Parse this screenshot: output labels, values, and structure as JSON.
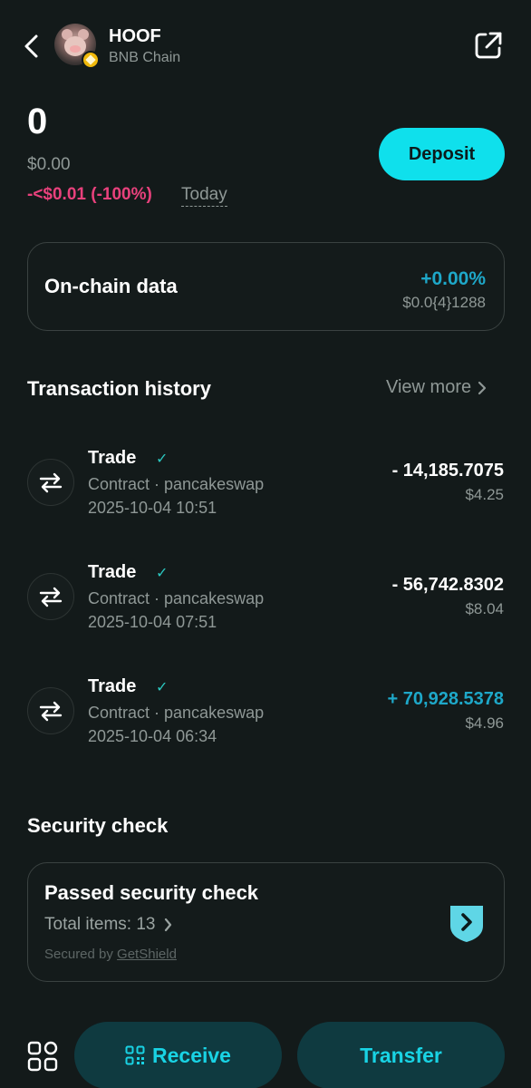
{
  "header": {
    "token_name": "HOOF",
    "chain_name": "BNB Chain"
  },
  "balance": {
    "amount": "0",
    "fiat": "$0.00",
    "change": "-<$0.01 (-100%)",
    "period": "Today",
    "deposit_label": "Deposit"
  },
  "onchain": {
    "title": "On-chain data",
    "change_pct": "+0.00%",
    "price": "$0.0{4}1288"
  },
  "transactions": {
    "title": "Transaction history",
    "view_more": "View more",
    "items": [
      {
        "type": "Trade",
        "contract": "Contract · pancakeswap",
        "date": "2025-10-04 10:51",
        "amount": "- 14,185.7075",
        "usd": "$4.25",
        "amount_color": "#ffffff"
      },
      {
        "type": "Trade",
        "contract": "Contract · pancakeswap",
        "date": "2025-10-04 07:51",
        "amount": "- 56,742.8302",
        "usd": "$8.04",
        "amount_color": "#ffffff"
      },
      {
        "type": "Trade",
        "contract": "Contract · pancakeswap",
        "date": "2025-10-04 06:34",
        "amount": "+ 70,928.5378",
        "usd": "$4.96",
        "amount_color": "#1ea8c9"
      }
    ]
  },
  "security": {
    "title": "Security check",
    "status": "Passed security check",
    "total_items": "Total items: 13",
    "secured_prefix": "Secured by ",
    "secured_by": "GetShield"
  },
  "bottom_bar": {
    "receive_label": "Receive",
    "transfer_label": "Transfer"
  },
  "colors": {
    "background": "#131a1a",
    "accent": "#0fe0ec",
    "negative": "#e8417c",
    "positive": "#1ea8c9"
  },
  "icons": {
    "back": "chevron-left-icon",
    "share": "external-link-icon",
    "transaction": "swap-arrows-icon",
    "verified": "check-icon",
    "shield": "shield-chevron-icon",
    "apps": "apps-grid-icon",
    "receive": "qr-code-icon"
  }
}
